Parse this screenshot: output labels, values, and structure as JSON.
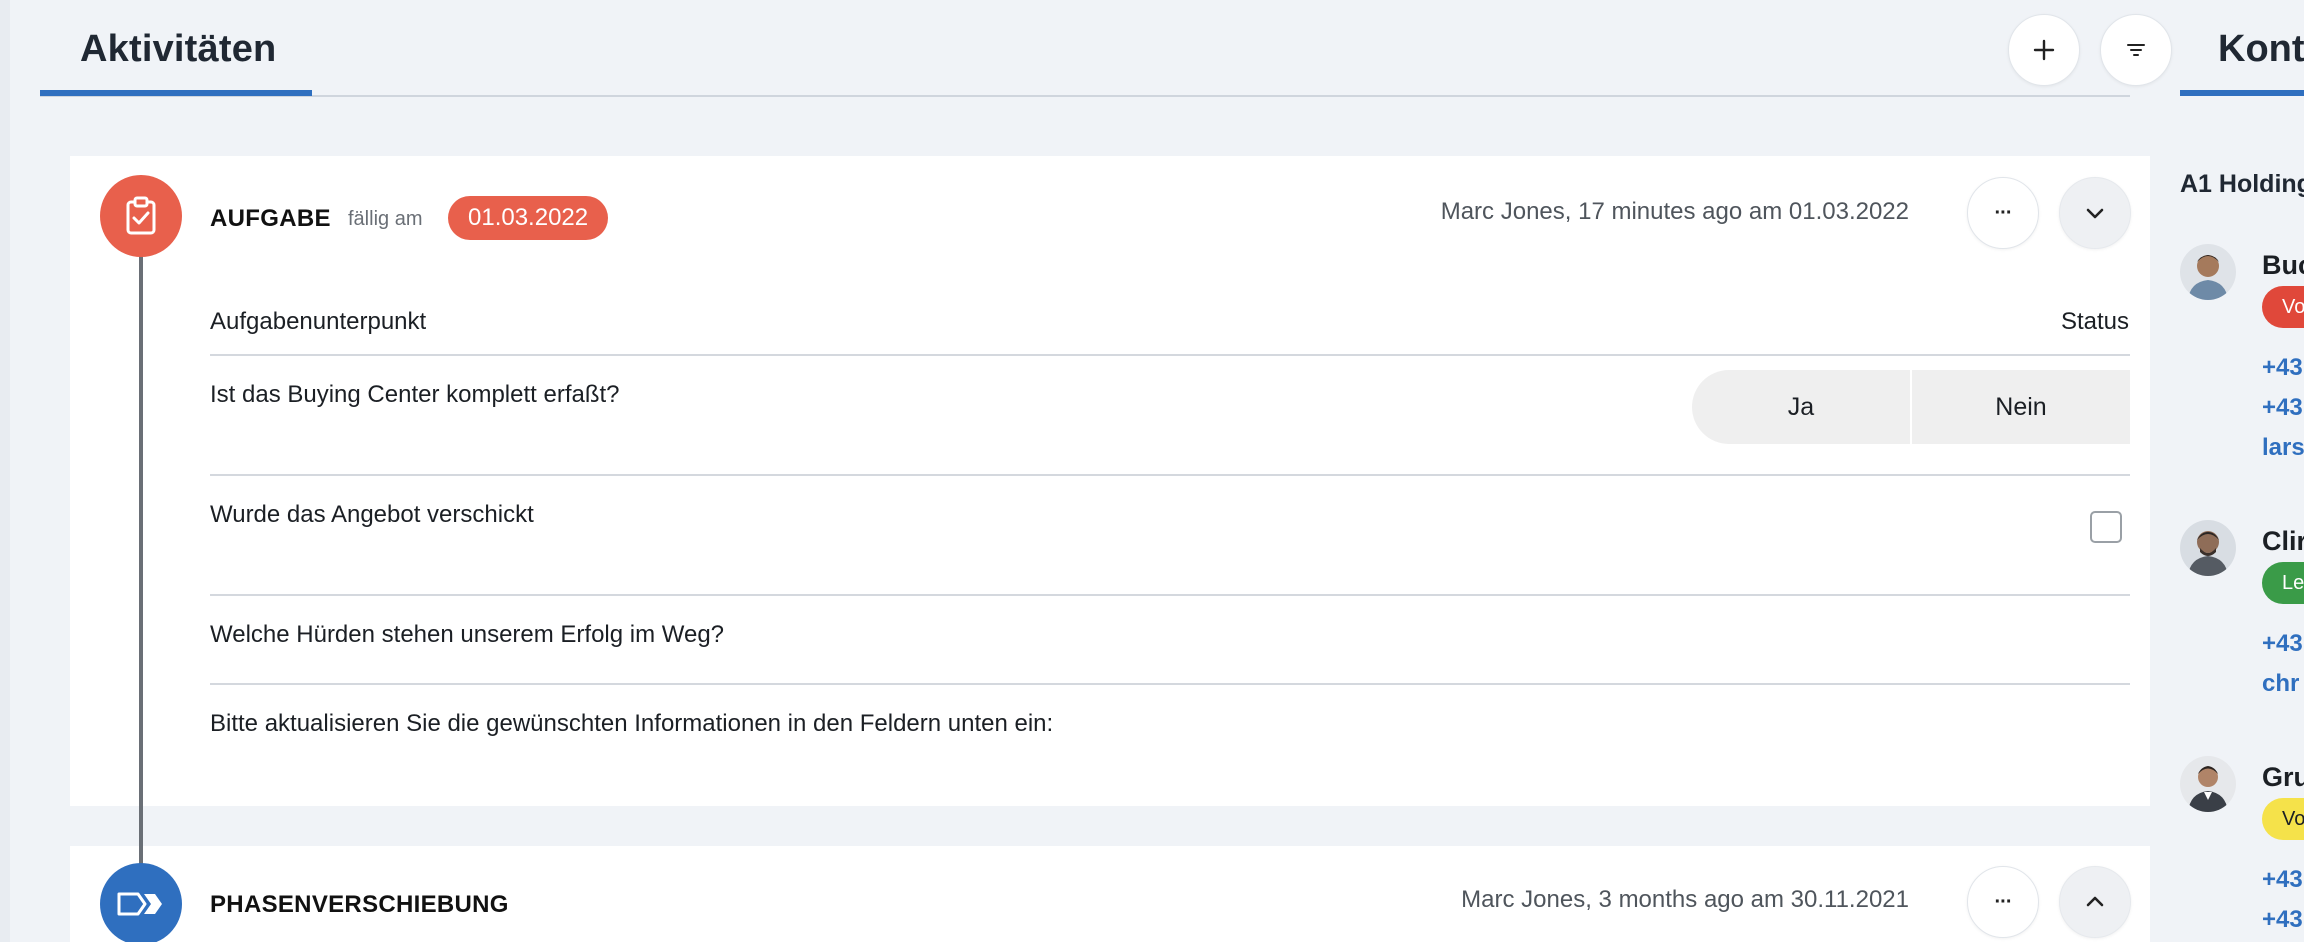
{
  "activities": {
    "title": "Aktivitäten",
    "add_icon": "plus-icon",
    "filter_icon": "filter-icon"
  },
  "task_card": {
    "type": "AUFGABE",
    "type_icon": "clipboard-check-icon",
    "due_label": "fällig am",
    "due_date": "01.03.2022",
    "meta": "Marc Jones, 17 minutes ago am 01.03.2022",
    "more_label": "···",
    "columns": {
      "item": "Aufgabenunterpunkt",
      "status": "Status"
    },
    "items": [
      "Ist das Buying Center komplett erfaßt?",
      "Wurde das Angebot verschickt",
      "Welche Hürden stehen unserem Erfolg im Weg?",
      "Bitte aktualisieren Sie die gewünschten Informationen in den Feldern unten ein:"
    ],
    "toggle": {
      "yes": "Ja",
      "no": "Nein"
    }
  },
  "phase_card": {
    "type": "PHASENVERSCHIEBUNG",
    "type_icon": "phase-arrow-icon",
    "meta": "Marc Jones, 3 months ago am 30.11.2021",
    "more_label": "···"
  },
  "contacts_panel": {
    "title": "Kont",
    "company": "A1 Holding",
    "contacts": [
      {
        "name": "Buc",
        "badge": "Vo",
        "badge_color": "#e0483a",
        "lines": [
          "+43",
          "+43",
          "lars"
        ]
      },
      {
        "name": "Clir",
        "badge": "Le",
        "badge_color": "#3a9b48",
        "lines": [
          "+43",
          "chr"
        ]
      },
      {
        "name": "Gru",
        "badge": "Vo",
        "badge_color": "#f5e24a",
        "lines": [
          "+43",
          "+43"
        ]
      }
    ]
  },
  "colors": {
    "accent": "#2f6fbf",
    "task": "#e8604c",
    "background": "#f0f3f7"
  }
}
